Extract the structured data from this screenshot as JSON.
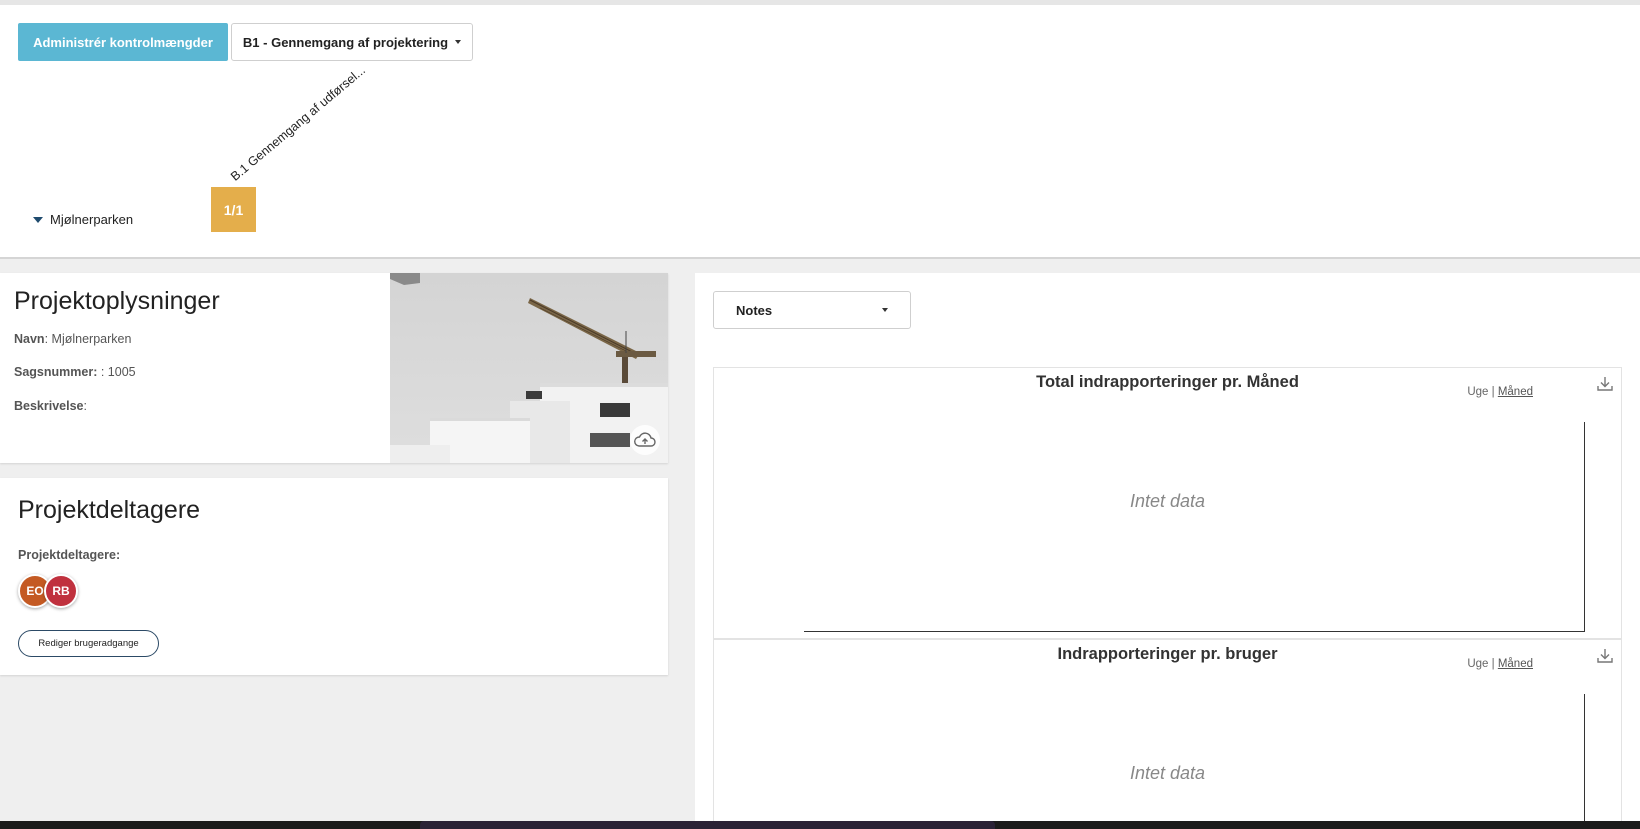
{
  "toolbar": {
    "admin_button_label": "Administrér kontrolmængder",
    "dropdown_label": "B1 - Gennemgang af projektering"
  },
  "matrix": {
    "column_header": "B.1 Gennemgang af udførsel...",
    "row_label": "Mjølnerparken",
    "cell_value": "1/1",
    "cell_color": "#e4ae4b"
  },
  "project_info": {
    "title": "Projektoplysninger",
    "name_label": "Navn",
    "name_value": "Mjølnerparken",
    "case_label": "Sagsnummer:",
    "case_value": ": 1005",
    "description_label": "Beskrivelse",
    "description_value": "",
    "image_icon": "construction-photo",
    "upload_icon": "cloud-upload-icon"
  },
  "participants": {
    "title": "Projektdeltagere",
    "label": "Projektdeltagere:",
    "avatars": [
      {
        "initials": "EO",
        "color": "#c45a23"
      },
      {
        "initials": "RB",
        "color": "#c0313e"
      }
    ],
    "edit_button_label": "Rediger brugeradgange"
  },
  "right_panel": {
    "notes_select_value": "Notes",
    "charts": [
      {
        "title": "Total indrapporteringer pr. Måned",
        "toggle_week": "Uge",
        "toggle_separator": "|",
        "toggle_month": "Måned",
        "empty_text": "Intet data"
      },
      {
        "title": "Indrapporteringer pr. bruger",
        "toggle_week": "Uge",
        "toggle_separator": "|",
        "toggle_month": "Måned",
        "empty_text": "Intet data"
      }
    ]
  },
  "colors": {
    "accent_button": "#5bb7d3",
    "edit_button_border": "#2c4a66"
  }
}
